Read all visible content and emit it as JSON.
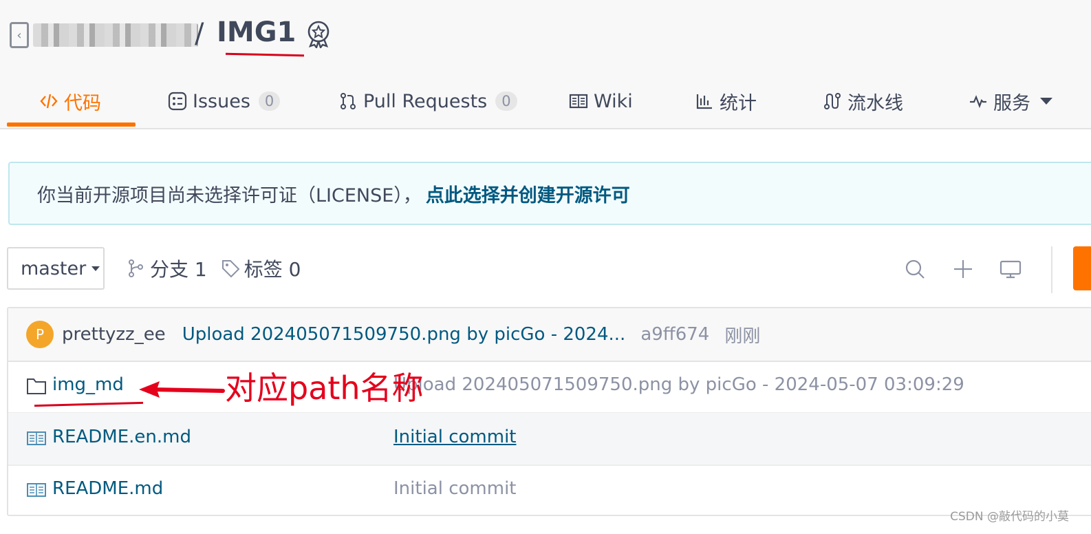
{
  "repo": {
    "slash": "/",
    "name": "IMG1",
    "owner_icon": "back-arrow-icon",
    "recommend_icon": "award-medal-icon"
  },
  "tabs": [
    {
      "label": "代码",
      "icon": "code-icon",
      "active": true
    },
    {
      "label": "Issues",
      "icon": "issues-icon",
      "count": "0"
    },
    {
      "label": "Pull Requests",
      "icon": "pull-request-icon",
      "count": "0"
    },
    {
      "label": "Wiki",
      "icon": "book-icon"
    },
    {
      "label": "统计",
      "icon": "bar-chart-icon"
    },
    {
      "label": "流水线",
      "icon": "pipeline-icon"
    },
    {
      "label": "服务",
      "icon": "pulse-icon",
      "dropdown": true
    }
  ],
  "notice": {
    "text": "你当前开源项目尚未选择许可证（LICENSE），",
    "link": "点此选择并创建开源许可"
  },
  "branch": {
    "current": "master",
    "branches_label": "分支 1",
    "tags_label": "标签 0"
  },
  "latest_commit": {
    "avatar_letter": "P",
    "author": "prettyzz_ee",
    "message": "Upload 202405071509750.png by picGo - 2024...",
    "sha": "a9ff674",
    "time": "刚刚"
  },
  "files": [
    {
      "name": "img_md",
      "type": "folder",
      "icon": "folder-icon",
      "commit": "Upload 202405071509750.png by picGo - 2024-05-07 03:09:29"
    },
    {
      "name": "README.en.md",
      "type": "file",
      "icon": "readme-book-icon",
      "commit": "Initial commit"
    },
    {
      "name": "README.md",
      "type": "file",
      "icon": "readme-book-icon",
      "commit": "Initial commit"
    }
  ],
  "annotation": {
    "text": "对应path名称"
  },
  "watermark": "CSDN @敲代码的小莫",
  "colors": {
    "accent": "#fe7300",
    "link": "#005980",
    "annotation": "#e5001c",
    "notice_bg": "#f3fcfd"
  }
}
